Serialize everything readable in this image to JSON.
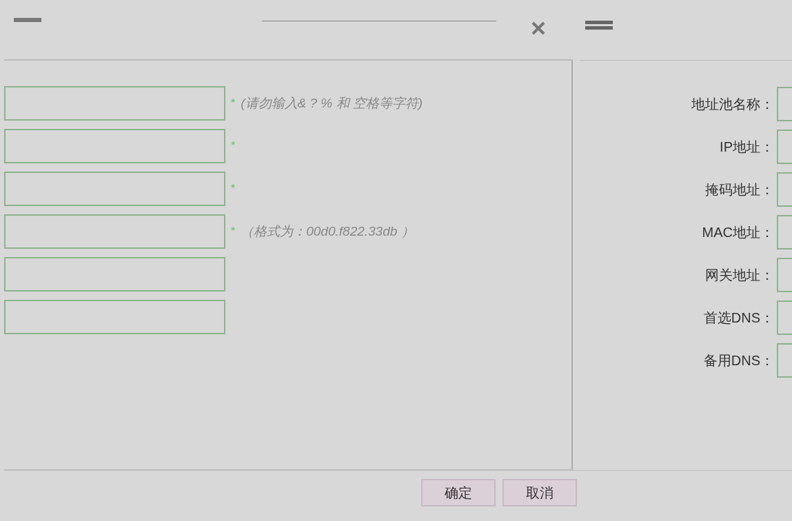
{
  "left_fields": [
    {
      "kind": "text_input",
      "mark": "*",
      "hint": "(请勿输入& ? % 和 空格等字符)"
    },
    {
      "kind": "text_input",
      "mark": "*"
    },
    {
      "kind": "text_input",
      "mark": "*"
    },
    {
      "kind": "text_input",
      "mark": "*",
      "hint": "（格式为：00d0.f822.33db ）"
    },
    {
      "kind": "text_input"
    },
    {
      "kind": "text_input"
    }
  ],
  "right_fields": [
    {
      "label": "地址池名称："
    },
    {
      "label": "IP地址："
    },
    {
      "label": "掩码地址："
    },
    {
      "label": "MAC地址："
    },
    {
      "label": "网关地址："
    },
    {
      "label": "首选DNS："
    },
    {
      "label": "备用DNS："
    }
  ],
  "buttons": [
    "确定",
    "取消"
  ]
}
